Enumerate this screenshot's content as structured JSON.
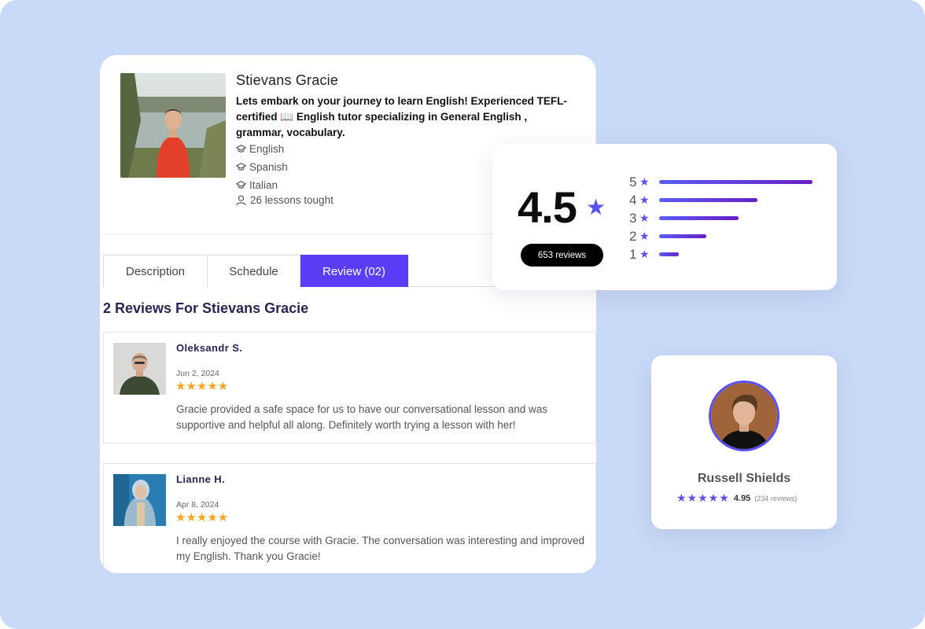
{
  "tutor": {
    "name": "Stievans Gracie",
    "bio": "Lets embark on your journey to learn English! Experienced TEFL-certified 📖 English tutor specializing in General English , grammar, vocabulary.",
    "languages": [
      "English",
      "Spanish",
      "Italian"
    ],
    "lessons": "26 lessons tought"
  },
  "tabs": [
    {
      "label": "Description"
    },
    {
      "label": "Schedule"
    },
    {
      "label": "Review (02)"
    }
  ],
  "reviews_heading": "2 Reviews For Stievans Gracie",
  "reviews": [
    {
      "name": "Oleksandr  S.",
      "date": "Jun 2, 2024",
      "rating": 5,
      "stars": "★★★★★",
      "text": "Gracie provided a safe space for us to have our conversational lesson and was supportive and helpful all along. Definitely worth trying a lesson with her!"
    },
    {
      "name": "Lianne  H.",
      "date": "Apr 8, 2024",
      "rating": 5,
      "stars": "★★★★★",
      "text": "I really enjoyed the course with Gracie. The conversation was interesting and improved my English. Thank you Gracie!"
    }
  ],
  "rating_summary": {
    "score": "4.5",
    "count_label": "653 reviews",
    "distribution": [
      {
        "stars": "5",
        "share": 1.0
      },
      {
        "stars": "4",
        "share": 0.64
      },
      {
        "stars": "3",
        "share": 0.52
      },
      {
        "stars": "2",
        "share": 0.31
      },
      {
        "stars": "1",
        "share": 0.13
      }
    ]
  },
  "featured_teacher": {
    "name": "Russell Shields",
    "stars": "★★★★★",
    "score": "4.95",
    "count": "(234 reviews)"
  },
  "colors": {
    "accent": "#5a3df6",
    "star_gold": "#f5a623",
    "background": "#c9d9f8",
    "heading": "#2c2358"
  },
  "icons": {
    "language": "graduation-cap-icon",
    "lessons": "user-icon",
    "rating": "star-icon"
  }
}
